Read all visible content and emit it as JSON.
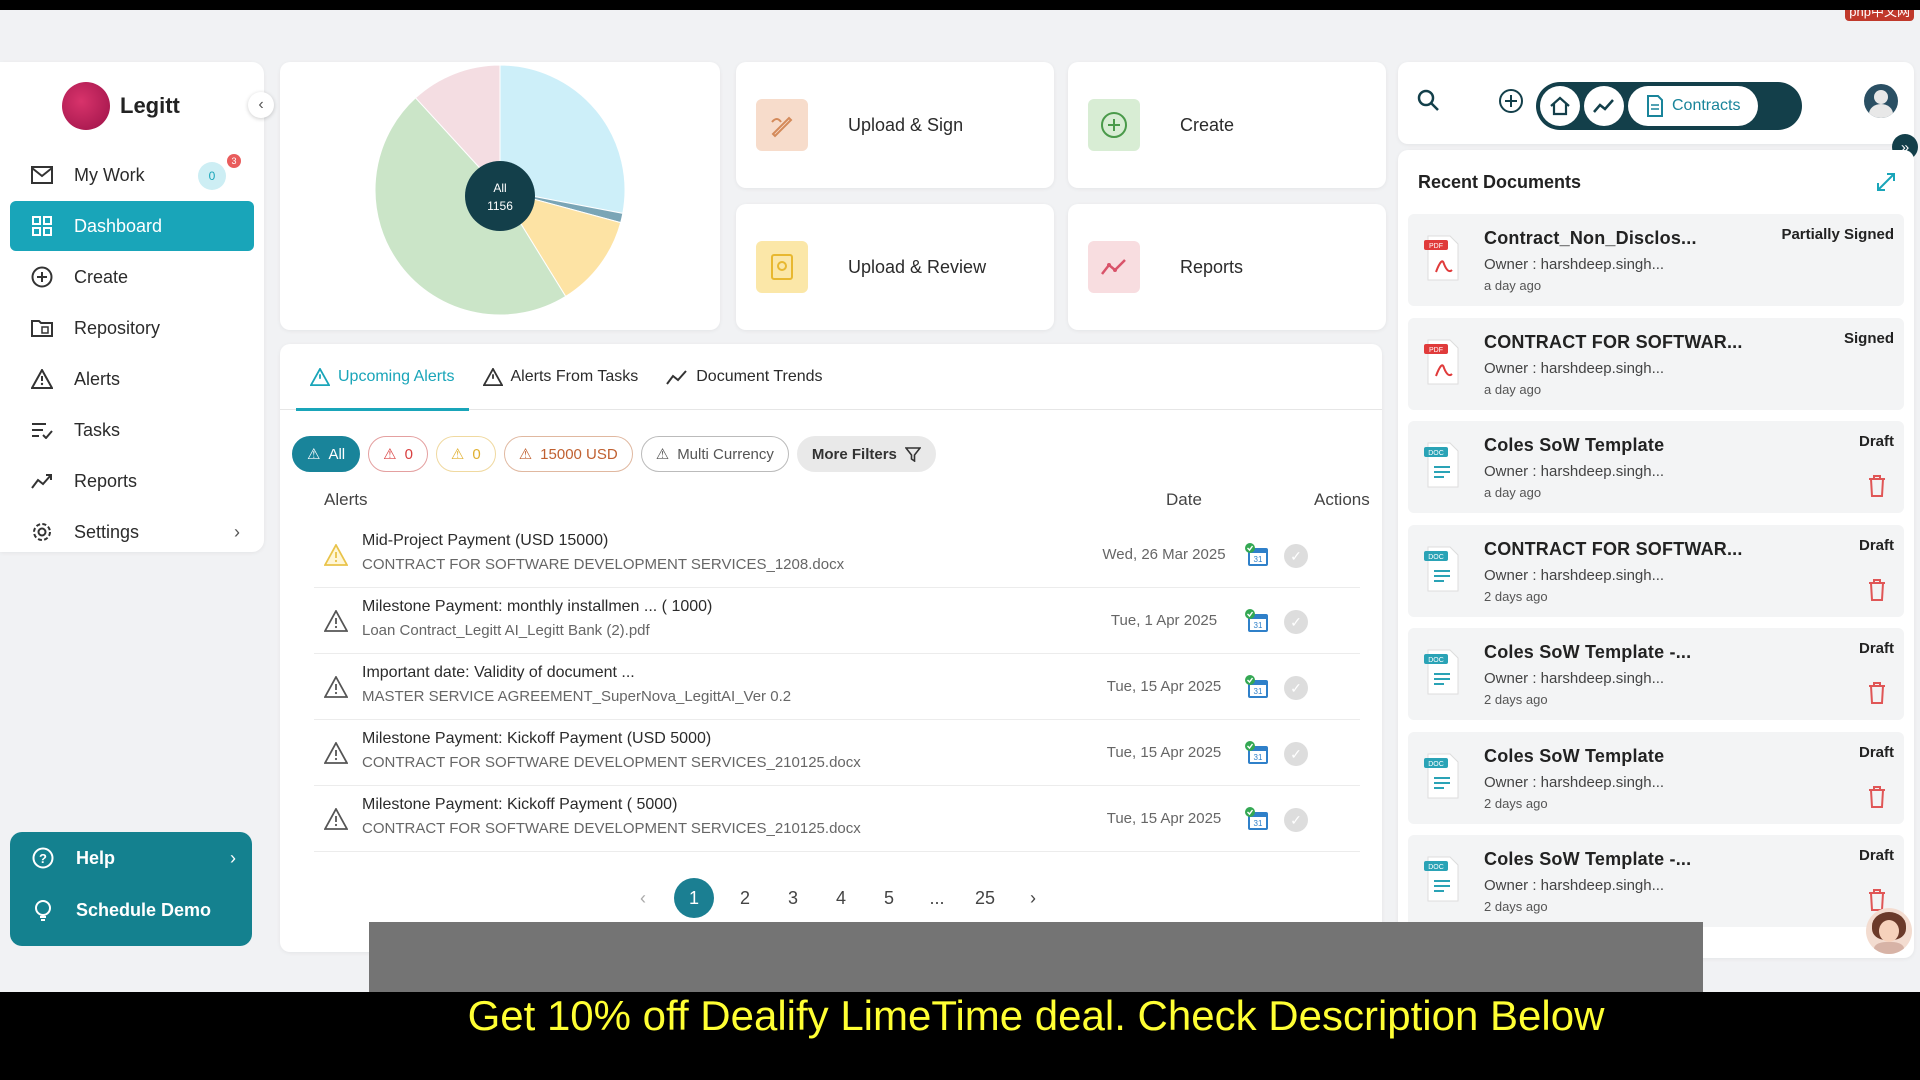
{
  "watermark": "php中文网",
  "brand": {
    "name": "Legitt"
  },
  "sidebar": {
    "items": [
      {
        "label": "My Work",
        "icon": "mail-icon",
        "badge": "0",
        "dot": "3"
      },
      {
        "label": "Dashboard",
        "icon": "dashboard-icon",
        "active": true
      },
      {
        "label": "Create",
        "icon": "plus-circle-icon"
      },
      {
        "label": "Repository",
        "icon": "folder-icon"
      },
      {
        "label": "Alerts",
        "icon": "warning-icon"
      },
      {
        "label": "Tasks",
        "icon": "tasks-icon"
      },
      {
        "label": "Reports",
        "icon": "trend-icon"
      },
      {
        "label": "Settings",
        "icon": "gear-icon"
      }
    ],
    "help": {
      "help_label": "Help",
      "demo_label": "Schedule Demo"
    }
  },
  "pie": {
    "center_label": "All",
    "center_value": "1156",
    "slices_fraction": [
      0.28,
      0.012,
      0.12,
      0.47,
      0.118
    ],
    "slice_colors": [
      "#cdeff9",
      "#7aa5b6",
      "#fde3a4",
      "#cbe5c8",
      "#f4dde2"
    ]
  },
  "quick_actions": [
    {
      "label": "Upload & Sign",
      "icon": "sign-icon",
      "color": "#f7dccb"
    },
    {
      "label": "Create",
      "icon": "plus-circle-icon",
      "color": "#d8edd4"
    },
    {
      "label": "Upload & Review",
      "icon": "review-icon",
      "color": "#fbe7a8"
    },
    {
      "label": "Reports",
      "icon": "trend-icon",
      "color": "#f8dde0"
    }
  ],
  "alerts": {
    "tabs": [
      "Upcoming Alerts",
      "Alerts From Tasks",
      "Document Trends"
    ],
    "filters": [
      "All",
      "0",
      "0",
      "15000 USD",
      "Multi Currency",
      "More Filters"
    ],
    "columns": {
      "alerts": "Alerts",
      "date": "Date",
      "actions": "Actions"
    },
    "rows": [
      {
        "title": "Mid-Project Payment (USD 15000)",
        "doc": "CONTRACT FOR SOFTWARE DEVELOPMENT SERVICES_1208.docx",
        "date": "Wed, 26 Mar 2025",
        "level": "yellow"
      },
      {
        "title": "Milestone Payment: monthly installmen ... ( 1000)",
        "doc": "Loan Contract_Legitt AI_Legitt Bank (2).pdf",
        "date": "Tue, 1 Apr 2025",
        "level": "gray"
      },
      {
        "title": "Important date: Validity of document ...",
        "doc": "MASTER SERVICE AGREEMENT_SuperNova_LegittAI_Ver 0.2",
        "date": "Tue, 15 Apr 2025",
        "level": "gray"
      },
      {
        "title": "Milestone Payment: Kickoff Payment (USD 5000)",
        "doc": "CONTRACT FOR SOFTWARE DEVELOPMENT SERVICES_210125.docx",
        "date": "Tue, 15 Apr 2025",
        "level": "gray"
      },
      {
        "title": "Milestone Payment: Kickoff Payment ( 5000)",
        "doc": "CONTRACT FOR SOFTWARE DEVELOPMENT SERVICES_210125.docx",
        "date": "Tue, 15 Apr 2025",
        "level": "gray"
      }
    ],
    "pagination": [
      "1",
      "2",
      "3",
      "4",
      "5",
      "...",
      "25"
    ]
  },
  "topbar": {
    "contracts_label": "Contracts"
  },
  "recent": {
    "title": "Recent Documents",
    "docs": [
      {
        "name": "Contract_Non_Disclos...",
        "owner": "Owner : harshdeep.singh...",
        "ago": "a day ago",
        "status": "Partially Signed",
        "type": "pdf"
      },
      {
        "name": "CONTRACT FOR SOFTWAR...",
        "owner": "Owner : harshdeep.singh...",
        "ago": "a day ago",
        "status": "Signed",
        "type": "pdf"
      },
      {
        "name": "Coles SoW Template",
        "owner": "Owner : harshdeep.singh...",
        "ago": "a day ago",
        "status": "Draft",
        "type": "doc"
      },
      {
        "name": "CONTRACT FOR SOFTWAR...",
        "owner": "Owner : harshdeep.singh...",
        "ago": "2 days ago",
        "status": "Draft",
        "type": "doc"
      },
      {
        "name": "Coles SoW Template -...",
        "owner": "Owner : harshdeep.singh...",
        "ago": "2 days ago",
        "status": "Draft",
        "type": "doc"
      },
      {
        "name": "Coles SoW Template",
        "owner": "Owner : harshdeep.singh...",
        "ago": "2 days ago",
        "status": "Draft",
        "type": "doc"
      },
      {
        "name": "Coles SoW Template -...",
        "owner": "Owner : harshdeep.singh...",
        "ago": "2 days ago",
        "status": "Draft",
        "type": "doc"
      }
    ]
  },
  "caption": "Get 10% off Dealify LimeTime deal. Check Description Below",
  "colors": {
    "accent": "#19a5b9",
    "dark_accent": "#133f4a"
  }
}
